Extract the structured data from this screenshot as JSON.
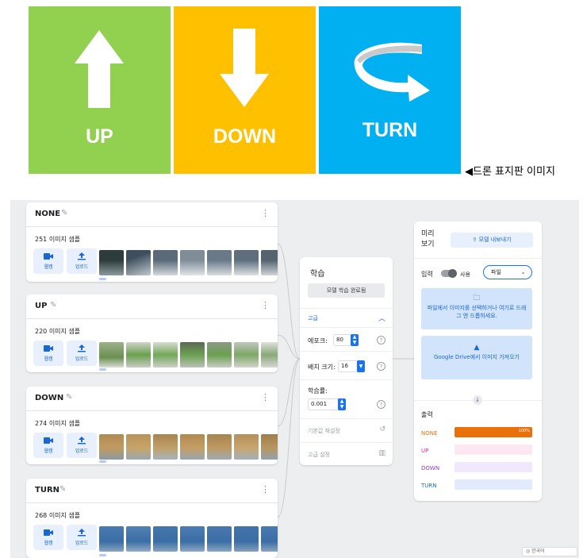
{
  "signs": [
    {
      "label": "UP",
      "color": "#92d050",
      "icon": "arrow-up-icon"
    },
    {
      "label": "DOWN",
      "color": "#ffc000",
      "icon": "arrow-down-icon"
    },
    {
      "label": "TURN",
      "color": "#00b0f0",
      "icon": "turn-arrow-icon"
    }
  ],
  "caption": "◀드론 표지판 이미지",
  "classes": [
    {
      "name": "NONE",
      "count": "251 이미지 샘플",
      "webcam": "웹캠",
      "upload": "업로드",
      "thumb_color": "#607080"
    },
    {
      "name": "UP",
      "count": "220 이미지 샘플",
      "webcam": "웹캠",
      "upload": "업로드",
      "thumb_color": "#6aa050"
    },
    {
      "name": "DOWN",
      "count": "274 이미지 샘플",
      "webcam": "웹캠",
      "upload": "업로드",
      "thumb_color": "#b08a50"
    },
    {
      "name": "TURN",
      "count": "268 이미지 샘플",
      "webcam": "웹캠",
      "upload": "업로드",
      "thumb_color": "#3a6ea5"
    }
  ],
  "training": {
    "title": "학습",
    "done_button": "모델 학습 완료됨",
    "advanced": "고급",
    "epochs_label": "에포크:",
    "epochs_value": "80",
    "batch_label": "배치 크기:",
    "batch_value": "16",
    "lr_label": "학습률:",
    "lr_value": "0.001",
    "reset": "기본값 재설정",
    "under_hood": "고급 설정"
  },
  "preview": {
    "title": "미리 보기",
    "export": "모델 내보내기",
    "input_label": "입력",
    "toggle_label": "사용",
    "source": "파일",
    "drop_text": "파일에서 이미지를 선택하거나 여기로 드래그 앤 드롭하세요.",
    "drive_text": "Google Drive에서 이미지 가져오기",
    "output_label": "출력",
    "outputs": [
      {
        "name": "NONE",
        "value": 100,
        "pct": "100%",
        "color": "#e8710a",
        "bg": "#fbe9e7"
      },
      {
        "name": "UP",
        "value": 0,
        "pct": "",
        "color": "#e52592",
        "bg": "#fde7f3"
      },
      {
        "name": "DOWN",
        "value": 0,
        "pct": "",
        "color": "#9334e6",
        "bg": "#f1e8fd"
      },
      {
        "name": "TURN",
        "value": 0,
        "pct": "",
        "color": "#1967d2",
        "bg": "#e1ebfc"
      }
    ]
  },
  "language": "◎ 한국어"
}
